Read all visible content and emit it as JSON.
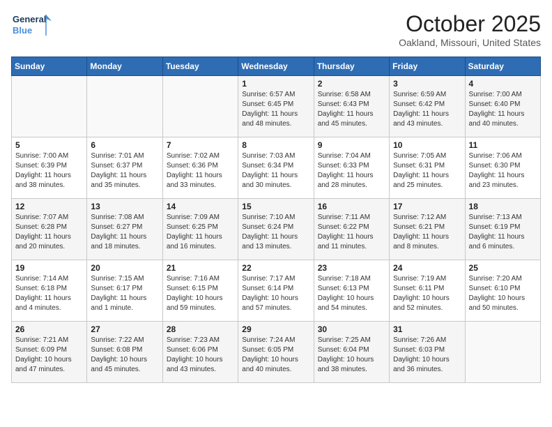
{
  "header": {
    "logo_line1": "General",
    "logo_line2": "Blue",
    "month": "October 2025",
    "location": "Oakland, Missouri, United States"
  },
  "weekdays": [
    "Sunday",
    "Monday",
    "Tuesday",
    "Wednesday",
    "Thursday",
    "Friday",
    "Saturday"
  ],
  "weeks": [
    [
      {
        "day": "",
        "info": ""
      },
      {
        "day": "",
        "info": ""
      },
      {
        "day": "",
        "info": ""
      },
      {
        "day": "1",
        "info": "Sunrise: 6:57 AM\nSunset: 6:45 PM\nDaylight: 11 hours\nand 48 minutes."
      },
      {
        "day": "2",
        "info": "Sunrise: 6:58 AM\nSunset: 6:43 PM\nDaylight: 11 hours\nand 45 minutes."
      },
      {
        "day": "3",
        "info": "Sunrise: 6:59 AM\nSunset: 6:42 PM\nDaylight: 11 hours\nand 43 minutes."
      },
      {
        "day": "4",
        "info": "Sunrise: 7:00 AM\nSunset: 6:40 PM\nDaylight: 11 hours\nand 40 minutes."
      }
    ],
    [
      {
        "day": "5",
        "info": "Sunrise: 7:00 AM\nSunset: 6:39 PM\nDaylight: 11 hours\nand 38 minutes."
      },
      {
        "day": "6",
        "info": "Sunrise: 7:01 AM\nSunset: 6:37 PM\nDaylight: 11 hours\nand 35 minutes."
      },
      {
        "day": "7",
        "info": "Sunrise: 7:02 AM\nSunset: 6:36 PM\nDaylight: 11 hours\nand 33 minutes."
      },
      {
        "day": "8",
        "info": "Sunrise: 7:03 AM\nSunset: 6:34 PM\nDaylight: 11 hours\nand 30 minutes."
      },
      {
        "day": "9",
        "info": "Sunrise: 7:04 AM\nSunset: 6:33 PM\nDaylight: 11 hours\nand 28 minutes."
      },
      {
        "day": "10",
        "info": "Sunrise: 7:05 AM\nSunset: 6:31 PM\nDaylight: 11 hours\nand 25 minutes."
      },
      {
        "day": "11",
        "info": "Sunrise: 7:06 AM\nSunset: 6:30 PM\nDaylight: 11 hours\nand 23 minutes."
      }
    ],
    [
      {
        "day": "12",
        "info": "Sunrise: 7:07 AM\nSunset: 6:28 PM\nDaylight: 11 hours\nand 20 minutes."
      },
      {
        "day": "13",
        "info": "Sunrise: 7:08 AM\nSunset: 6:27 PM\nDaylight: 11 hours\nand 18 minutes."
      },
      {
        "day": "14",
        "info": "Sunrise: 7:09 AM\nSunset: 6:25 PM\nDaylight: 11 hours\nand 16 minutes."
      },
      {
        "day": "15",
        "info": "Sunrise: 7:10 AM\nSunset: 6:24 PM\nDaylight: 11 hours\nand 13 minutes."
      },
      {
        "day": "16",
        "info": "Sunrise: 7:11 AM\nSunset: 6:22 PM\nDaylight: 11 hours\nand 11 minutes."
      },
      {
        "day": "17",
        "info": "Sunrise: 7:12 AM\nSunset: 6:21 PM\nDaylight: 11 hours\nand 8 minutes."
      },
      {
        "day": "18",
        "info": "Sunrise: 7:13 AM\nSunset: 6:19 PM\nDaylight: 11 hours\nand 6 minutes."
      }
    ],
    [
      {
        "day": "19",
        "info": "Sunrise: 7:14 AM\nSunset: 6:18 PM\nDaylight: 11 hours\nand 4 minutes."
      },
      {
        "day": "20",
        "info": "Sunrise: 7:15 AM\nSunset: 6:17 PM\nDaylight: 11 hours\nand 1 minute."
      },
      {
        "day": "21",
        "info": "Sunrise: 7:16 AM\nSunset: 6:15 PM\nDaylight: 10 hours\nand 59 minutes."
      },
      {
        "day": "22",
        "info": "Sunrise: 7:17 AM\nSunset: 6:14 PM\nDaylight: 10 hours\nand 57 minutes."
      },
      {
        "day": "23",
        "info": "Sunrise: 7:18 AM\nSunset: 6:13 PM\nDaylight: 10 hours\nand 54 minutes."
      },
      {
        "day": "24",
        "info": "Sunrise: 7:19 AM\nSunset: 6:11 PM\nDaylight: 10 hours\nand 52 minutes."
      },
      {
        "day": "25",
        "info": "Sunrise: 7:20 AM\nSunset: 6:10 PM\nDaylight: 10 hours\nand 50 minutes."
      }
    ],
    [
      {
        "day": "26",
        "info": "Sunrise: 7:21 AM\nSunset: 6:09 PM\nDaylight: 10 hours\nand 47 minutes."
      },
      {
        "day": "27",
        "info": "Sunrise: 7:22 AM\nSunset: 6:08 PM\nDaylight: 10 hours\nand 45 minutes."
      },
      {
        "day": "28",
        "info": "Sunrise: 7:23 AM\nSunset: 6:06 PM\nDaylight: 10 hours\nand 43 minutes."
      },
      {
        "day": "29",
        "info": "Sunrise: 7:24 AM\nSunset: 6:05 PM\nDaylight: 10 hours\nand 40 minutes."
      },
      {
        "day": "30",
        "info": "Sunrise: 7:25 AM\nSunset: 6:04 PM\nDaylight: 10 hours\nand 38 minutes."
      },
      {
        "day": "31",
        "info": "Sunrise: 7:26 AM\nSunset: 6:03 PM\nDaylight: 10 hours\nand 36 minutes."
      },
      {
        "day": "",
        "info": ""
      }
    ]
  ]
}
